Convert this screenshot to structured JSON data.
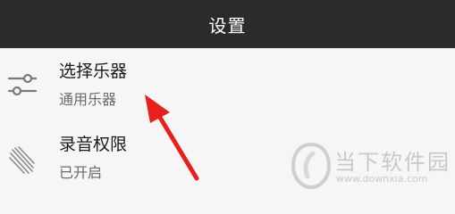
{
  "header": {
    "title": "设置"
  },
  "settings": [
    {
      "title": "选择乐器",
      "subtitle": "通用乐器",
      "icon": "sliders-icon"
    },
    {
      "title": "录音权限",
      "subtitle": "已开启",
      "icon": "streaks-icon"
    }
  ],
  "annotation": {
    "arrow_color": "#e8201c"
  },
  "watermark": {
    "name": "当下软件园",
    "url": "www.downxia.com"
  },
  "colors": {
    "header_bg": "#2b2b2b",
    "page_bg": "#f6f6f6",
    "watermark": "#c8c8c8"
  }
}
